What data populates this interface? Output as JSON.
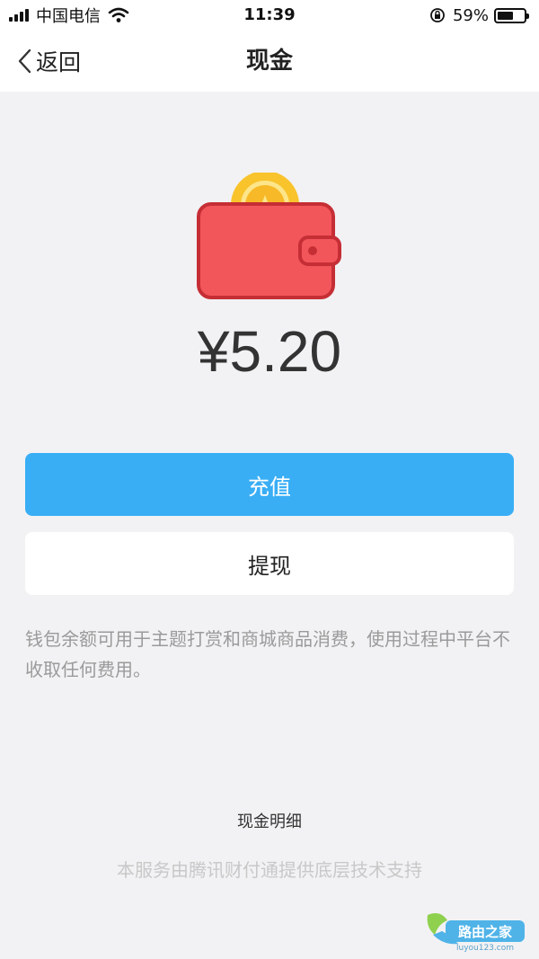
{
  "status_bar": {
    "carrier": "中国电信",
    "time": "11:39",
    "battery_percent": "59%",
    "battery_level": 0.59
  },
  "nav": {
    "back_label": "返回",
    "title": "现金"
  },
  "wallet": {
    "amount": "¥5.20"
  },
  "actions": {
    "recharge_label": "充值",
    "withdraw_label": "提现"
  },
  "note": "钱包余额可用于主题打赏和商城商品消费，使用过程中平台不收取任何费用。",
  "footer": {
    "detail_link": "现金明细",
    "support_text": "本服务由腾讯财付通提供底层技术支持",
    "watermark_title": "路由之家",
    "watermark_url": "luyou123.com"
  },
  "colors": {
    "primary_button": "#39aef5",
    "wallet_body": "#f05a5e",
    "coin": "#fbc02d"
  }
}
